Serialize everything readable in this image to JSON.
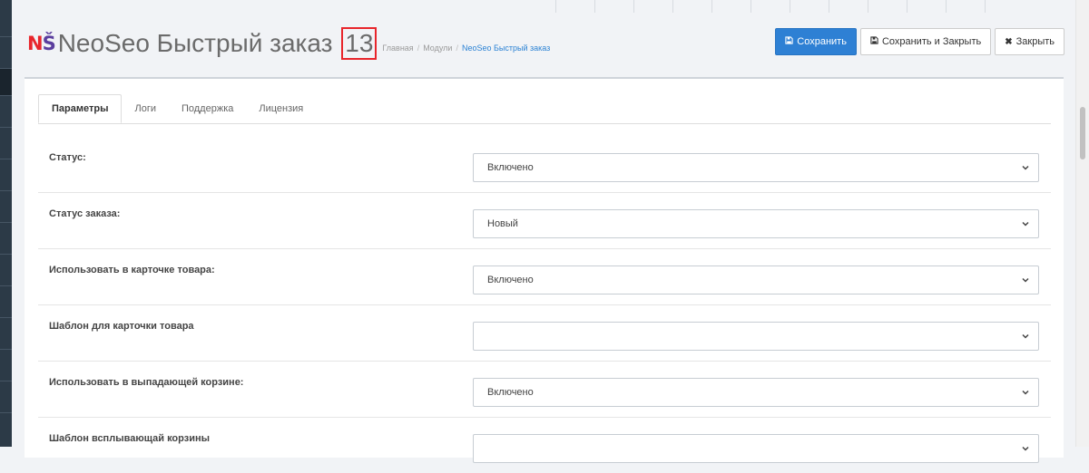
{
  "logo": {
    "n": "N",
    "s": "Š"
  },
  "header": {
    "title": "NeoSeo Быстрый заказ",
    "count": "13"
  },
  "breadcrumb": [
    {
      "label": "Главная"
    },
    {
      "label": "Модули"
    },
    {
      "label": "NeoSeo Быстрый заказ"
    }
  ],
  "breadcrumb_separator": "/",
  "toolbar": {
    "save_label": "Сохранить",
    "save_close_label": "Сохранить и Закрыть",
    "close_label": "Закрыть",
    "save_icon": "save-icon",
    "close_icon": "times-icon",
    "primary_color": "#2e80d4"
  },
  "tabs": [
    {
      "label": "Параметры",
      "active": true
    },
    {
      "label": "Логи",
      "active": false
    },
    {
      "label": "Поддержка",
      "active": false
    },
    {
      "label": "Лицензия",
      "active": false
    }
  ],
  "form": {
    "rows": [
      {
        "label": "Статус:",
        "value": "Включено"
      },
      {
        "label": "Статус заказа:",
        "value": "Новый"
      },
      {
        "label": "Использовать в карточке товара:",
        "value": "Включено"
      },
      {
        "label": "Шаблон для карточки товара",
        "value": ""
      },
      {
        "label": "Использовать в выпадающей корзине:",
        "value": "Включено"
      },
      {
        "label": "Шаблон всплывающай корзины",
        "value": ""
      }
    ]
  },
  "colors": {
    "logo_red": "#e8252b",
    "logo_purple": "#5b3e9e",
    "highlight_box": "#e8252b",
    "breadcrumb_link": "#2b82d4"
  }
}
